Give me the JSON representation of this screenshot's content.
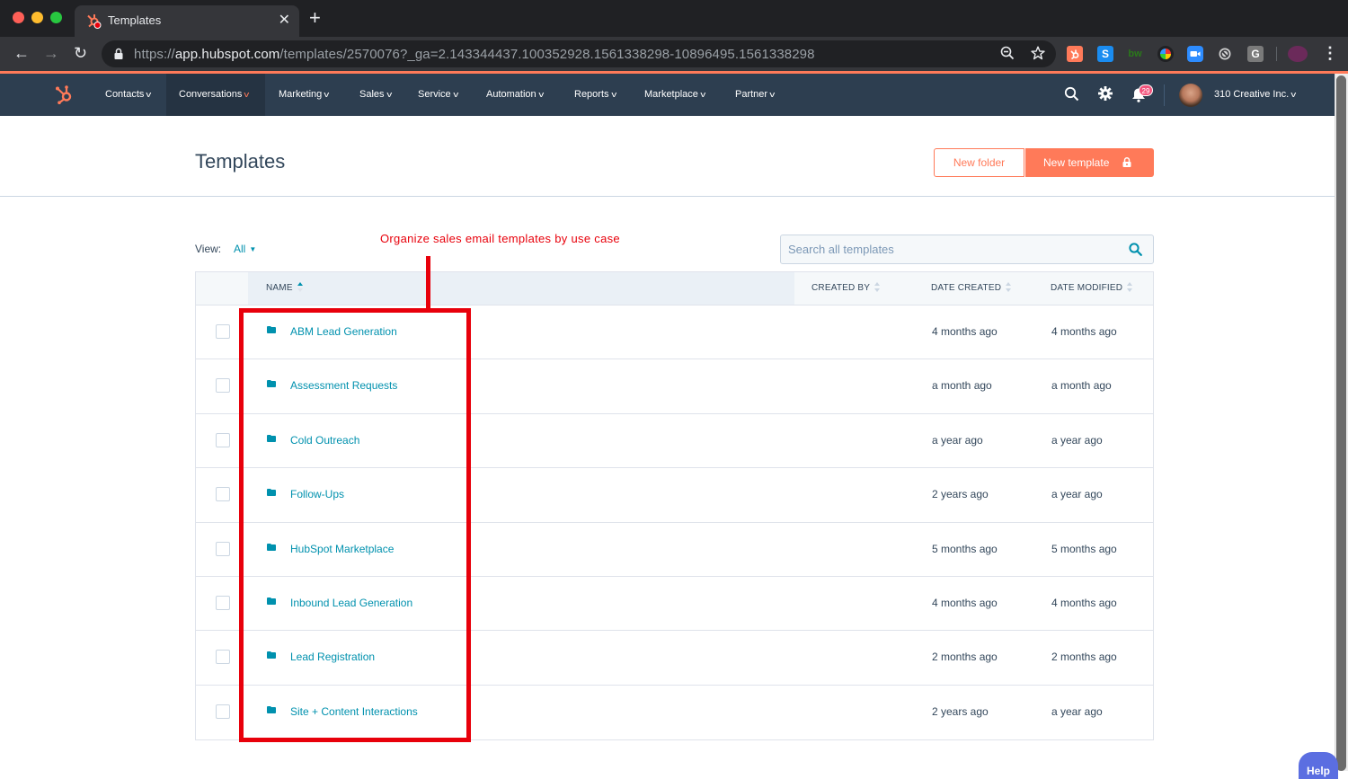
{
  "browser": {
    "tab_title": "Templates",
    "tab_close_glyph": "✕",
    "new_tab_glyph": "+",
    "url_scheme": "https://",
    "url_host": "app.hubspot.com",
    "url_path": "/templates/2570076?_ga=2.143344437.100352928.1561338298-10896495.1561338298",
    "back_glyph": "←",
    "forward_glyph": "→",
    "reload_glyph": "↻",
    "menu_glyph": "⋮",
    "extensions": [
      {
        "name": "hubspot-extension",
        "label": "",
        "color": "#ff7a59"
      },
      {
        "name": "s-extension",
        "label": "S",
        "color": "#1a8cf0"
      },
      {
        "name": "bw-extension",
        "label": "bw",
        "color": "#35363a"
      },
      {
        "name": "color-extension",
        "label": "",
        "color": "#202124"
      },
      {
        "name": "zoom-extension",
        "label": "",
        "color": "#2d8cff"
      },
      {
        "name": "block-extension",
        "label": "",
        "color": "#35363a"
      },
      {
        "name": "g-extension",
        "label": "G",
        "color": "#7a7a7a"
      },
      {
        "name": "profile-extension",
        "label": "",
        "color": "#6b2a5a"
      }
    ]
  },
  "nav": {
    "items": [
      {
        "label": "Contacts",
        "active": false
      },
      {
        "label": "Conversations",
        "active": true
      },
      {
        "label": "Marketing",
        "active": false
      },
      {
        "label": "Sales",
        "active": false
      },
      {
        "label": "Service",
        "active": false
      },
      {
        "label": "Automation",
        "active": false
      },
      {
        "label": "Reports",
        "active": false
      },
      {
        "label": "Marketplace",
        "active": false
      },
      {
        "label": "Partner",
        "active": false
      }
    ],
    "chevron_glyph": "v",
    "notification_count": "29",
    "account_name": "310 Creative Inc.",
    "account_chevron": "v"
  },
  "page": {
    "title": "Templates",
    "new_folder_label": "New folder",
    "new_template_label": "New template"
  },
  "filters": {
    "view_label": "View:",
    "view_value": "All",
    "view_caret": "▼",
    "search_placeholder": "Search all templates"
  },
  "annotation": {
    "text": "Organize sales email templates by use case",
    "color": "#e8000b"
  },
  "table": {
    "columns": {
      "name": "NAME",
      "created_by": "CREATED BY",
      "date_created": "DATE CREATED",
      "date_modified": "DATE MODIFIED"
    },
    "sort": {
      "column": "name",
      "direction": "ascending"
    },
    "rows": [
      {
        "name": "ABM Lead Generation",
        "created_by": "",
        "date_created": "4 months ago",
        "date_modified": "4 months ago"
      },
      {
        "name": "Assessment Requests",
        "created_by": "",
        "date_created": "a month ago",
        "date_modified": "a month ago"
      },
      {
        "name": "Cold Outreach",
        "created_by": "",
        "date_created": "a year ago",
        "date_modified": "a year ago"
      },
      {
        "name": "Follow-Ups",
        "created_by": "",
        "date_created": "2 years ago",
        "date_modified": "a year ago"
      },
      {
        "name": "HubSpot Marketplace",
        "created_by": "",
        "date_created": "5 months ago",
        "date_modified": "5 months ago"
      },
      {
        "name": "Inbound Lead Generation",
        "created_by": "",
        "date_created": "4 months ago",
        "date_modified": "4 months ago"
      },
      {
        "name": "Lead Registration",
        "created_by": "",
        "date_created": "2 months ago",
        "date_modified": "2 months ago"
      },
      {
        "name": "Site + Content Interactions",
        "created_by": "",
        "date_created": "2 years ago",
        "date_modified": "a year ago"
      }
    ]
  },
  "help": {
    "label": "Help"
  },
  "colors": {
    "brand_orange": "#ff7a59",
    "nav_bg": "#2d3e50",
    "link": "#0091ae",
    "text": "#33475b"
  }
}
